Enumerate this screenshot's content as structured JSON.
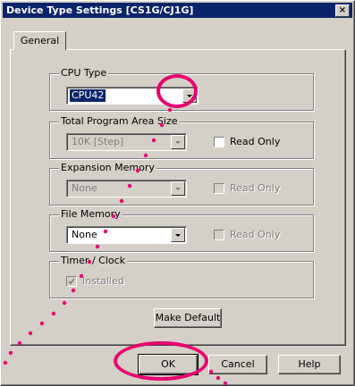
{
  "window": {
    "title": "Device Type Settings [CS1G/CJ1G]",
    "close_label": "×"
  },
  "tabs": [
    {
      "label": "General",
      "active": true
    }
  ],
  "groups": {
    "cpu_type": {
      "legend": "CPU Type",
      "value": "CPU42",
      "enabled": true
    },
    "program_area": {
      "legend": "Total Program Area Size",
      "value": "10K [Step]",
      "enabled": false,
      "read_only_label": "Read Only",
      "read_only_checked": false,
      "read_only_enabled": true
    },
    "expansion_memory": {
      "legend": "Expansion Memory",
      "value": "None",
      "enabled": false,
      "read_only_label": "Read Only",
      "read_only_checked": false,
      "read_only_enabled": false
    },
    "file_memory": {
      "legend": "File Memory",
      "value": "None",
      "enabled": true,
      "read_only_label": "Read Only",
      "read_only_checked": false,
      "read_only_enabled": false
    },
    "timer_clock": {
      "legend": "Timer / Clock",
      "installed_label": "Installed",
      "installed_checked": true,
      "installed_enabled": false
    }
  },
  "buttons": {
    "make_default": "Make Default",
    "ok": "OK",
    "cancel": "Cancel",
    "help": "Help"
  },
  "colors": {
    "title_bar": "#0a246a",
    "dialog_face": "#d4d0c8",
    "highlight_annotation": "#e8006e"
  }
}
